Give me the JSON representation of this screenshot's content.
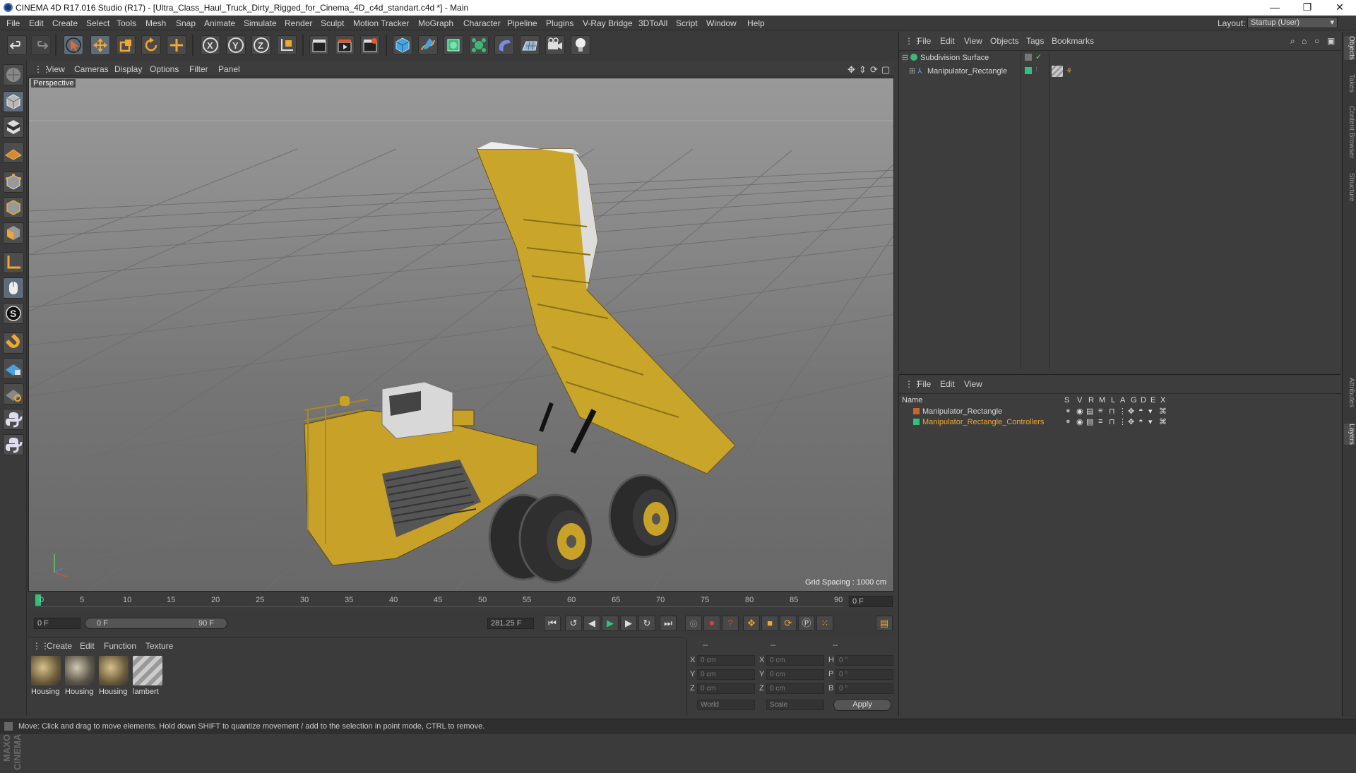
{
  "window": {
    "title": "CINEMA 4D R17.016 Studio (R17) - [Ultra_Class_Haul_Truck_Dirty_Rigged_for_Cinema_4D_c4d_standart.c4d *] - Main",
    "minimize": "—",
    "maximize": "❐",
    "close": "✕"
  },
  "menubar": {
    "items": [
      "File",
      "Edit",
      "Create",
      "Select",
      "Tools",
      "Mesh",
      "Snap",
      "Animate",
      "Simulate",
      "Render",
      "Sculpt",
      "Motion Tracker",
      "MoGraph",
      "Character",
      "Pipeline",
      "Plugins",
      "V-Ray Bridge",
      "3DToAll",
      "Script",
      "Window",
      "Help"
    ],
    "layout_label": "Layout:",
    "layout_value": "Startup (User)"
  },
  "viewport": {
    "menu": [
      "View",
      "Cameras",
      "Display",
      "Options",
      "Filter",
      "Panel"
    ],
    "camera_label": "Perspective",
    "grid_spacing": "Grid Spacing : 1000 cm"
  },
  "timeline": {
    "ticks": [
      "0",
      "5",
      "10",
      "15",
      "20",
      "25",
      "30",
      "35",
      "40",
      "45",
      "50",
      "55",
      "60",
      "65",
      "70",
      "75",
      "80",
      "85",
      "90"
    ],
    "end_frame": "0 F"
  },
  "transport": {
    "current_frame": "0 F",
    "range_start": "0 F",
    "range_end": "90 F",
    "fps_value": "281.25 F"
  },
  "materials": {
    "menu": [
      "Create",
      "Edit",
      "Function",
      "Texture"
    ],
    "items": [
      {
        "label": "Housing"
      },
      {
        "label": "Housing"
      },
      {
        "label": "Housing"
      },
      {
        "label": "lambert"
      }
    ]
  },
  "coords": {
    "headers": [
      "--",
      "--",
      "--"
    ],
    "rows": [
      {
        "a": "X",
        "av": "0 cm",
        "b": "X",
        "bv": "0 cm",
        "c": "H",
        "cv": "0 °"
      },
      {
        "a": "Y",
        "av": "0 cm",
        "b": "Y",
        "bv": "0 cm",
        "c": "P",
        "cv": "0 °"
      },
      {
        "a": "Z",
        "av": "0 cm",
        "b": "Z",
        "bv": "0 cm",
        "c": "B",
        "cv": "0 °"
      }
    ],
    "world": "World",
    "scale": "Scale",
    "apply": "Apply"
  },
  "status": "Move: Click and drag to move elements. Hold down SHIFT to quantize movement / add to the selection in point mode, CTRL to remove.",
  "objects": {
    "menu": [
      "File",
      "Edit",
      "View",
      "Objects",
      "Tags",
      "Bookmarks"
    ],
    "rows": [
      {
        "name": "Subdivision Surface"
      },
      {
        "name": "Manipulator_Rectangle"
      }
    ]
  },
  "layers": {
    "menu": [
      "File",
      "Edit",
      "View"
    ],
    "columns": [
      "Name",
      "S",
      "V",
      "R",
      "M",
      "L",
      "A",
      "G",
      "D",
      "E",
      "X"
    ],
    "rows": [
      {
        "name": "Manipulator_Rectangle",
        "color": "#c8652a"
      },
      {
        "name": "Manipulator_Rectangle_Controllers",
        "color": "#2ec27e"
      }
    ]
  },
  "right_tabs": [
    "Objects",
    "Takes",
    "Content Browser",
    "Structure",
    "Attributes",
    "Layers"
  ],
  "logo": [
    "MAXON",
    "CINEMA 4D"
  ]
}
